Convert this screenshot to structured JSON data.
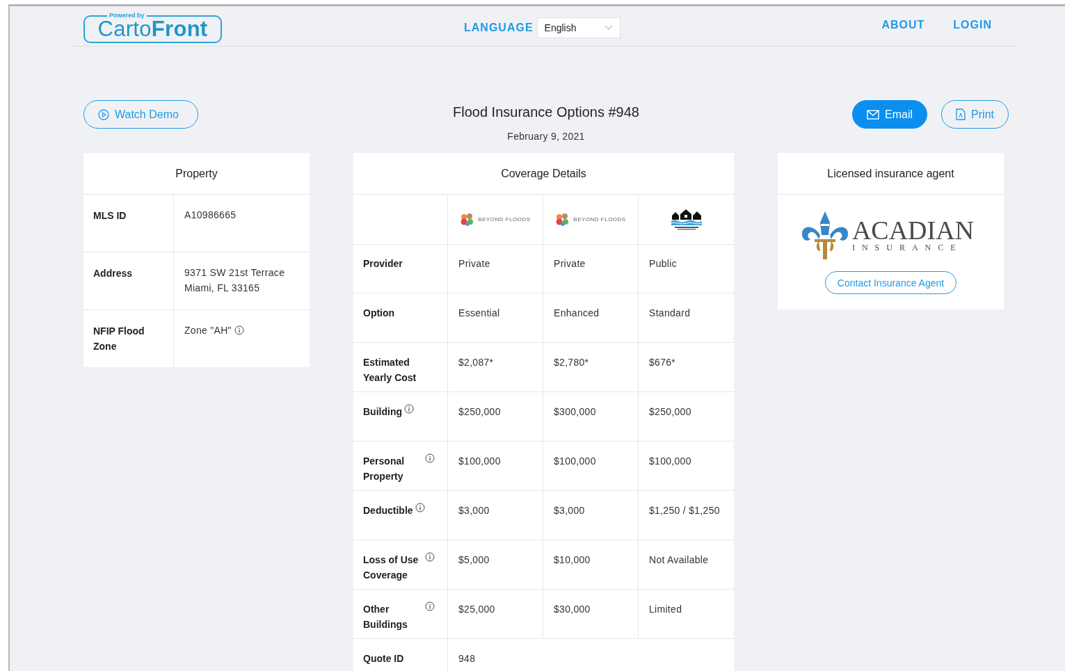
{
  "header": {
    "logo": {
      "tagline": "Powered by",
      "name": "Carto**Front**"
    },
    "language_label": "LANGUAGE",
    "language_value": "English",
    "nav": [
      "ABOUT",
      "LOGIN"
    ]
  },
  "title_bar": {
    "watch_demo": "Watch Demo",
    "title": "Flood Insurance Options #948",
    "date": "February 9, 2021",
    "actions": [
      {
        "kind": "email",
        "label": "Email"
      },
      {
        "kind": "print",
        "label": "Print"
      }
    ]
  },
  "property": {
    "title": "Property",
    "rows": [
      {
        "label": "MLS ID",
        "value": [
          "A10986665"
        ],
        "info": false
      },
      {
        "label": "Address",
        "value": [
          "9371 SW 21st Terrace",
          "Miami, FL 33165"
        ],
        "info": false
      },
      {
        "label": "NFIP Flood Zone",
        "value": [
          "Zone \"AH\""
        ],
        "info": true
      }
    ]
  },
  "coverage": {
    "title": "Coverage Details",
    "providers": [
      {
        "kind": "beyond",
        "name": "BEYOND FLOODS"
      },
      {
        "kind": "beyond",
        "name": "BEYOND FLOODS"
      },
      {
        "kind": "nfip"
      }
    ],
    "rows": [
      {
        "label": "Provider",
        "info": false,
        "values": [
          "Private",
          "Private",
          "Public"
        ]
      },
      {
        "label": "Option",
        "info": false,
        "values": [
          "Essential",
          "Enhanced",
          "Standard"
        ]
      },
      {
        "label": "Estimated Yearly Cost",
        "info": false,
        "values": [
          "$2,087*",
          "$2,780*",
          "$676*"
        ]
      },
      {
        "label": "Building",
        "info": true,
        "values": [
          "$250,000",
          "$300,000",
          "$250,000"
        ]
      },
      {
        "label": "Personal Property",
        "info": true,
        "values": [
          "$100,000",
          "$100,000",
          "$100,000"
        ]
      },
      {
        "label": "Deductible",
        "info": true,
        "values": [
          "$3,000",
          "$3,000",
          "$1,250 / $1,250"
        ]
      },
      {
        "label": "Loss of Use Coverage",
        "info": true,
        "values": [
          "$5,000",
          "$10,000",
          "Not Available"
        ]
      },
      {
        "label": "Other Buildings",
        "info": true,
        "values": [
          "$25,000",
          "$30,000",
          "Limited"
        ]
      },
      {
        "label": "Quote ID",
        "info": false,
        "values": [
          "948"
        ]
      }
    ]
  },
  "agent": {
    "title": "Licensed insurance agent",
    "logo": {
      "name": "ACADIAN",
      "sub": "INSURANCE"
    },
    "button": "Contact Insurance Agent"
  }
}
